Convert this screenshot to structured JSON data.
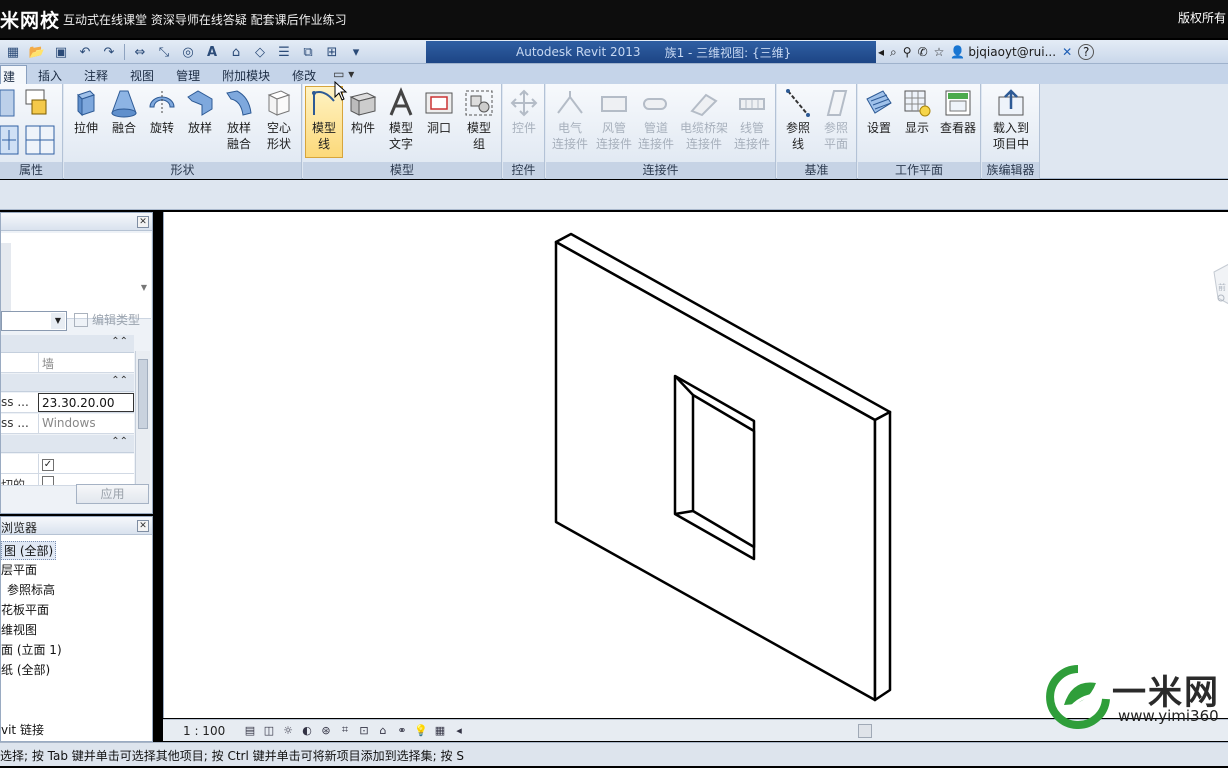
{
  "banner": {
    "brand": "米网校",
    "slogan": "互动式在线课堂  资深导师在线答疑  配套课后作业练习",
    "rights": "版权所有"
  },
  "titlebar": {
    "app": "Autodesk Revit 2013",
    "doc": "族1 - 三维视图: {三维}",
    "user": "bjqiaoyt@rui...",
    "help": "?"
  },
  "tabs": [
    "建",
    "插入",
    "注释",
    "视图",
    "管理",
    "附加模块",
    "修改"
  ],
  "ribbon": {
    "panels": {
      "properties": "属性",
      "forms": "形状",
      "model": "模型",
      "control": "控件",
      "connectors": "连接件",
      "datum": "基准",
      "workplane": "工作平面",
      "family_editor": "族编辑器"
    },
    "tools": {
      "extrude": "拉伸",
      "blend": "融合",
      "revolve": "旋转",
      "sweep": "放样",
      "swept_blend": [
        "放样",
        "融合"
      ],
      "void": [
        "空心",
        "形状"
      ],
      "model_line": [
        "模型",
        "线"
      ],
      "component": "构件",
      "model_text": [
        "模型",
        "文字"
      ],
      "opening": "洞口",
      "model_group": [
        "模型",
        "组"
      ],
      "control": "控件",
      "electrical": [
        "电气",
        "连接件"
      ],
      "duct": [
        "风管",
        "连接件"
      ],
      "pipe": [
        "管道",
        "连接件"
      ],
      "cable_tray": [
        "电缆桥架",
        "连接件"
      ],
      "conduit": [
        "线管",
        "连接件"
      ],
      "ref_line": [
        "参照",
        "线"
      ],
      "ref_plane": [
        "参照",
        "平面"
      ],
      "set": "设置",
      "show": "显示",
      "viewer": "查看器",
      "load_into_project": [
        "载入到",
        "项目中"
      ]
    }
  },
  "properties": {
    "edit_type": "编辑类型",
    "rows": [
      {
        "key": "",
        "value": "墙"
      },
      {
        "key": "ss ...",
        "value": "23.30.20.00"
      },
      {
        "key": "ss ...",
        "value": "Windows"
      },
      {
        "key": "",
        "value": ""
      },
      {
        "key": "切的",
        "value": ""
      }
    ],
    "apply": "应用"
  },
  "browser": {
    "title": "浏览器",
    "nodes": [
      "图 (全部)",
      "层平面",
      "参照标高",
      "花板平面",
      "维视图",
      "面 (立面 1)",
      "纸 (全部)",
      "vit 链接"
    ]
  },
  "viewbar": {
    "scale": "1 : 100"
  },
  "statusbar": {
    "text": "选择; 按 Tab 键并单击可选择其他项目; 按 Ctrl 键并单击可将新项目添加到选择集; 按 S"
  },
  "watermark": {
    "text": "一米网",
    "url": "www.yimi360"
  },
  "colors": {
    "accent": "#1d4585",
    "ribbon_bg": "#dfe7f1",
    "selected_tool": "#fcd97a"
  }
}
